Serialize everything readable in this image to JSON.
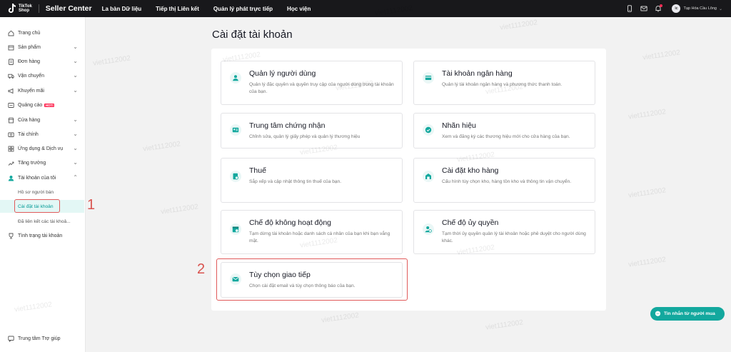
{
  "topbar": {
    "logo_text_1": "TikTok",
    "logo_text_2": "Shop",
    "brand": "Seller Center",
    "nav": [
      "La bàn Dữ liệu",
      "Tiếp thị Liên kết",
      "Quản lý phát trực tiếp",
      "Học viện"
    ],
    "avatar_initials": "ic",
    "shop_name": "Tạp Hóa Cầu Lông",
    "icons": [
      "phone-icon",
      "mail-icon",
      "bell-icon"
    ]
  },
  "sidebar": {
    "items": [
      {
        "label": "Trang chủ",
        "icon": "home-icon"
      },
      {
        "label": "Sản phẩm",
        "icon": "box-icon"
      },
      {
        "label": "Đơn hàng",
        "icon": "order-icon"
      },
      {
        "label": "Vận chuyển",
        "icon": "truck-icon"
      },
      {
        "label": "Khuyến mãi",
        "icon": "megaphone-icon"
      },
      {
        "label": "Quảng cáo",
        "icon": "ad-icon",
        "badge": "HOT!"
      },
      {
        "label": "Cửa hàng",
        "icon": "store-icon"
      },
      {
        "label": "Tài chính",
        "icon": "finance-icon"
      },
      {
        "label": "Ứng dụng & Dịch vụ",
        "icon": "apps-icon"
      },
      {
        "label": "Tăng trưởng",
        "icon": "growth-icon"
      },
      {
        "label": "Tài khoản của tôi",
        "icon": "user-icon"
      }
    ],
    "sub_items": [
      "Hồ sơ người bán",
      "Cài đặt tài khoản",
      "Đã liên kết các tài khoả..."
    ],
    "status_item": "Tình trạng tài khoản",
    "help": "Trung tâm Trợ giúp"
  },
  "annotations": {
    "one": "1",
    "two": "2"
  },
  "main": {
    "title": "Cài đặt tài khoản",
    "cards": [
      {
        "title": "Quản lý người dùng",
        "desc": "Quản lý đặc quyền và quyền truy cập của người dùng trong tài khoản của bạn.",
        "icon": "user-manage-icon"
      },
      {
        "title": "Tài khoản ngân hàng",
        "desc": "Quản lý tài khoản ngân hàng và phương thức thanh toán.",
        "icon": "bank-card-icon"
      },
      {
        "title": "Trung tâm chứng nhận",
        "desc": "Chỉnh sửa, quản lý giấy phép và quản lý thương hiệu",
        "icon": "id-card-icon"
      },
      {
        "title": "Nhãn hiệu",
        "desc": "Xem và đăng ký các thương hiệu mới cho cửa hàng của bạn.",
        "icon": "verified-badge-icon"
      },
      {
        "title": "Thuế",
        "desc": "Sắp xếp và cập nhật thông tin thuế của bạn.",
        "icon": "tax-document-icon"
      },
      {
        "title": "Cài đặt kho hàng",
        "desc": "Cấu hình tùy chọn kho, hàng tồn kho và thông tin vận chuyển.",
        "icon": "warehouse-icon"
      },
      {
        "title": "Chế độ không hoạt động",
        "desc": "Tạm dừng tài khoản hoặc danh sách cá nhân của bạn khi bạn vắng mặt.",
        "icon": "calendar-pause-icon"
      },
      {
        "title": "Chế độ ủy quyền",
        "desc": "Tạm thời ủy quyền quản lý tài khoản hoặc phê duyệt cho người dùng khác.",
        "icon": "delegate-user-icon"
      },
      {
        "title": "Tùy chọn giao tiếp",
        "desc": "Chọn cài đặt email và tùy chọn thông báo của bạn.",
        "icon": "envelope-icon"
      }
    ]
  },
  "watermark": "viet1112002",
  "chat_button": "Tin nhắn từ người mua",
  "colors": {
    "accent": "#13a89e",
    "topbar": "#18181b",
    "highlight": "#e05a5a",
    "hot": "#fe2c55"
  }
}
